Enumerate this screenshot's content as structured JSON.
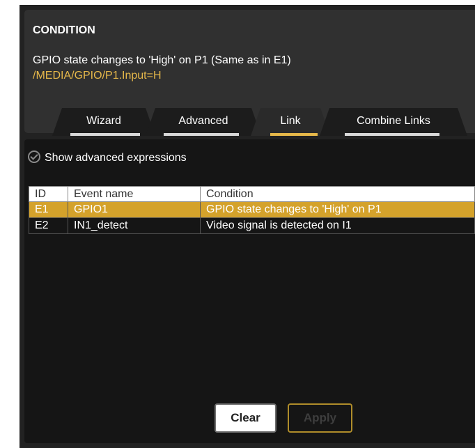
{
  "condition": {
    "title": "CONDITION",
    "description": "GPIO state changes to 'High' on P1 (Same as in E1)",
    "expression": "/MEDIA/GPIO/P1.Input=H"
  },
  "tabs": [
    {
      "label": "Wizard",
      "active": false
    },
    {
      "label": "Advanced",
      "active": false
    },
    {
      "label": "Link",
      "active": true
    },
    {
      "label": "Combine Links",
      "active": false
    }
  ],
  "options": {
    "show_advanced_label": "Show advanced expressions",
    "show_advanced_checked": false
  },
  "table": {
    "headers": [
      "ID",
      "Event name",
      "Condition"
    ],
    "rows": [
      {
        "id": "E1",
        "name": "GPIO1",
        "condition": "GPIO state changes to 'High' on P1",
        "selected": true
      },
      {
        "id": "E2",
        "name": "IN1_detect",
        "condition": "Video signal is detected on I1",
        "selected": false
      }
    ]
  },
  "buttons": {
    "clear": "Clear",
    "apply": "Apply"
  },
  "colors": {
    "accent": "#d4a22b",
    "expression": "#e6b84a",
    "background": "#222222"
  }
}
